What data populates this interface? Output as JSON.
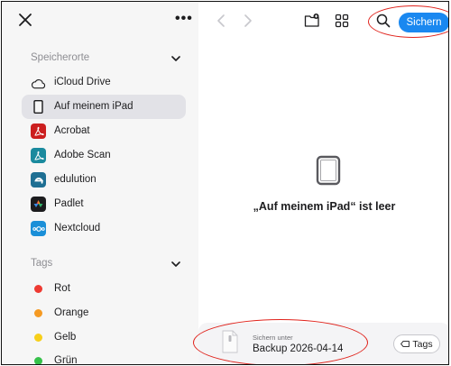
{
  "sidebar": {
    "more_label": "•••",
    "locations_header": "Speicherorte",
    "locations": [
      {
        "label": "iCloud Drive",
        "icon": "icloud-icon"
      },
      {
        "label": "Auf meinem iPad",
        "icon": "ipad-icon",
        "selected": true
      },
      {
        "label": "Acrobat",
        "icon": "acrobat-icon",
        "color": "#cc1f1f"
      },
      {
        "label": "Adobe Scan",
        "icon": "adobe-scan-icon",
        "color": "#1a8a9e"
      },
      {
        "label": "edulution",
        "icon": "edulution-icon",
        "color": "#1e6f93"
      },
      {
        "label": "Padlet",
        "icon": "padlet-icon",
        "color": "#1c1c1e"
      },
      {
        "label": "Nextcloud",
        "icon": "nextcloud-icon",
        "color": "#1a8fd8"
      }
    ],
    "tags_header": "Tags",
    "tags": [
      {
        "label": "Rot",
        "color": "#ee3a32"
      },
      {
        "label": "Orange",
        "color": "#f59a23"
      },
      {
        "label": "Gelb",
        "color": "#f7cf1a"
      },
      {
        "label": "Grün",
        "color": "#36c14a"
      }
    ]
  },
  "toolbar": {
    "save_label": "Sichern",
    "accent": "#1a88f0"
  },
  "main": {
    "empty_message": "„Auf meinem iPad“ ist leer"
  },
  "bottom_bar": {
    "save_under_label": "Sichern unter",
    "file_name": "Backup 2026-04-14",
    "tags_label": "Tags"
  },
  "annotation_color": "#e0231c"
}
